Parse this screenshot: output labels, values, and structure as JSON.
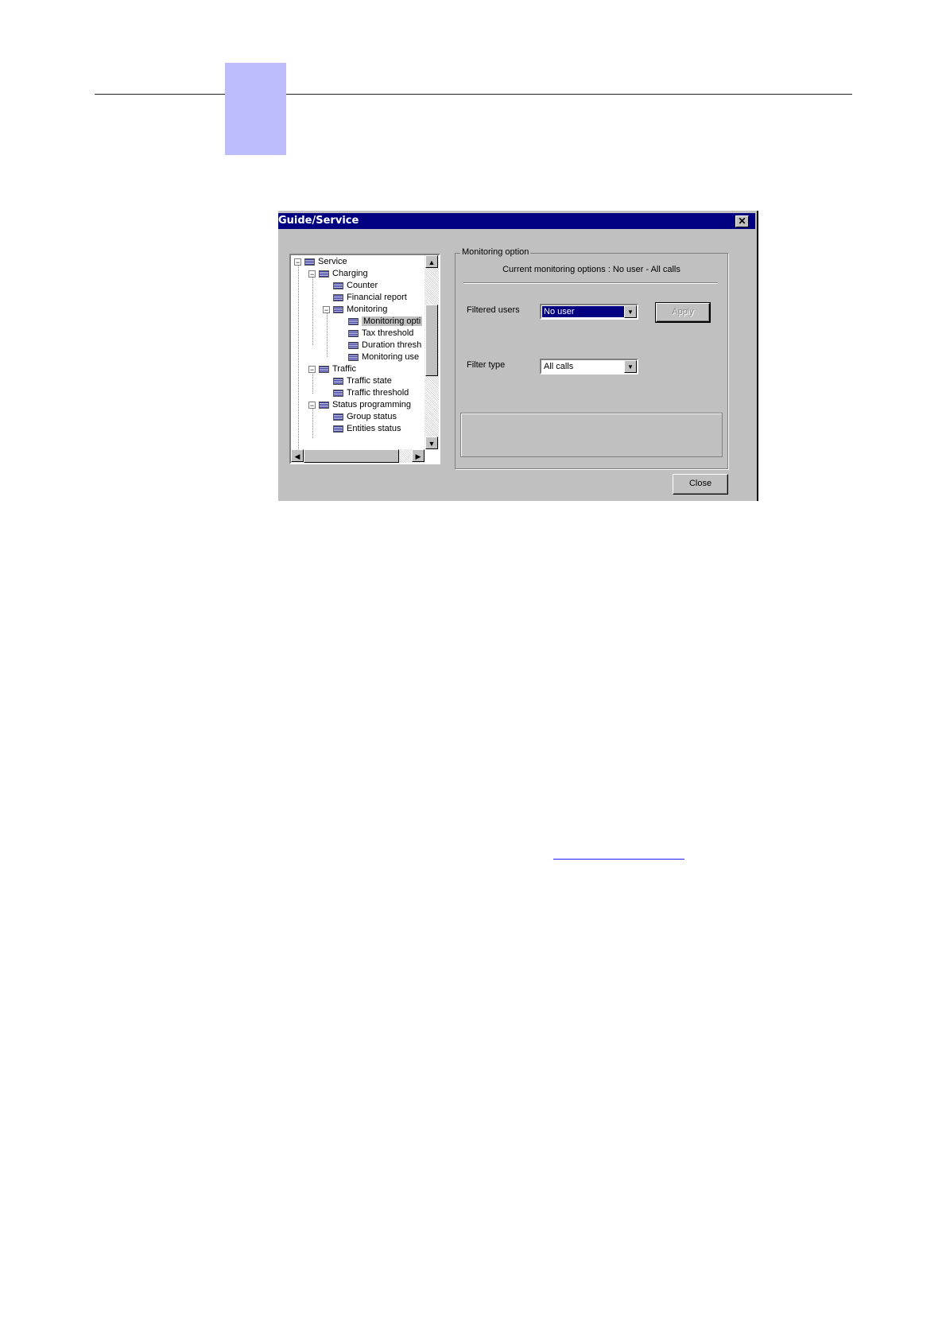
{
  "dialog": {
    "title": "Guide/Service",
    "close_glyph": "✕",
    "close_button": "Close"
  },
  "tree": {
    "items": [
      {
        "label": "Service",
        "expander": "−"
      },
      {
        "label": "Charging",
        "expander": "−"
      },
      {
        "label": "Counter"
      },
      {
        "label": "Financial report"
      },
      {
        "label": "Monitoring",
        "expander": "−"
      },
      {
        "label": "Monitoring opti",
        "selected": true
      },
      {
        "label": "Tax threshold"
      },
      {
        "label": "Duration thresh"
      },
      {
        "label": "Monitoring use"
      },
      {
        "label": "Traffic",
        "expander": "−"
      },
      {
        "label": "Traffic state"
      },
      {
        "label": "Traffic threshold"
      },
      {
        "label": "Status programming",
        "expander": "−"
      },
      {
        "label": "Group status"
      },
      {
        "label": "Entities status"
      }
    ],
    "scroll_up": "▲",
    "scroll_down": "▼",
    "scroll_left": "◀",
    "scroll_right": "▶"
  },
  "monitoring": {
    "group_label": "Monitoring option",
    "current_options": "Current monitoring options : No user - All calls",
    "filtered_users_label": "Filtered users",
    "filtered_users_value": "No user",
    "apply_button": "Apply",
    "filter_type_label": "Filter type",
    "filter_type_value": "All calls",
    "dropdown_glyph": "▼"
  },
  "colors": {
    "titlebar": "#000080",
    "chapter_tab": "#bdbdfd",
    "selection": "#000080"
  }
}
